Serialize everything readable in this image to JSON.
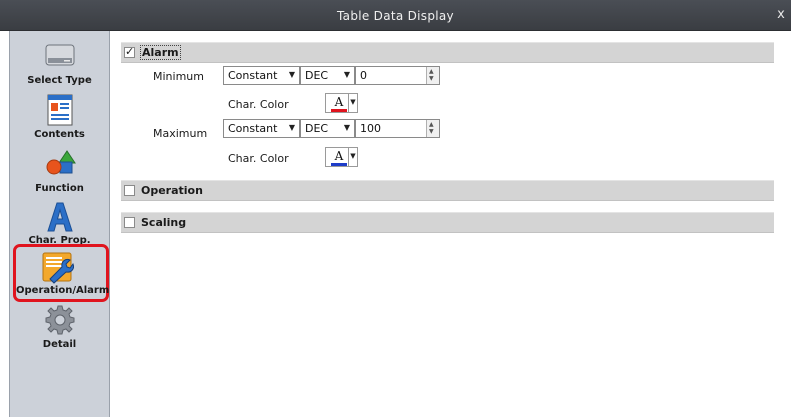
{
  "window": {
    "title": "Table Data Display",
    "close_glyph": "x"
  },
  "sidebar": {
    "items": [
      {
        "label": "Select Type",
        "icon": "select-type-icon"
      },
      {
        "label": "Contents",
        "icon": "contents-icon"
      },
      {
        "label": "Function",
        "icon": "function-icon"
      },
      {
        "label": "Char. Prop.",
        "icon": "char-prop-icon"
      },
      {
        "label": "Operation/Alarm",
        "icon": "operation-alarm-icon",
        "selected": true
      },
      {
        "label": "Detail",
        "icon": "detail-icon"
      }
    ]
  },
  "sections": {
    "alarm": {
      "label": "Alarm",
      "checked": true,
      "check_glyph": "✓",
      "minimum": {
        "label": "Minimum",
        "source": "Constant",
        "format": "DEC",
        "value": "0",
        "char_color_label": "Char. Color",
        "char_color": "#e0141e"
      },
      "maximum": {
        "label": "Maximum",
        "source": "Constant",
        "format": "DEC",
        "value": "100",
        "char_color_label": "Char. Color",
        "char_color": "#1e3cc8"
      }
    },
    "operation": {
      "label": "Operation",
      "checked": false
    },
    "scaling": {
      "label": "Scaling",
      "checked": false
    }
  },
  "glyphs": {
    "dropdown_arrow": "▼",
    "spin_up": "▲",
    "spin_down": "▼",
    "color_letter": "A"
  },
  "colors": {
    "selection_outline": "#e0141e",
    "titlebar": "#3f4248",
    "sidebar_bg": "#ccd1d9",
    "section_bar": "#d4d4d4"
  }
}
